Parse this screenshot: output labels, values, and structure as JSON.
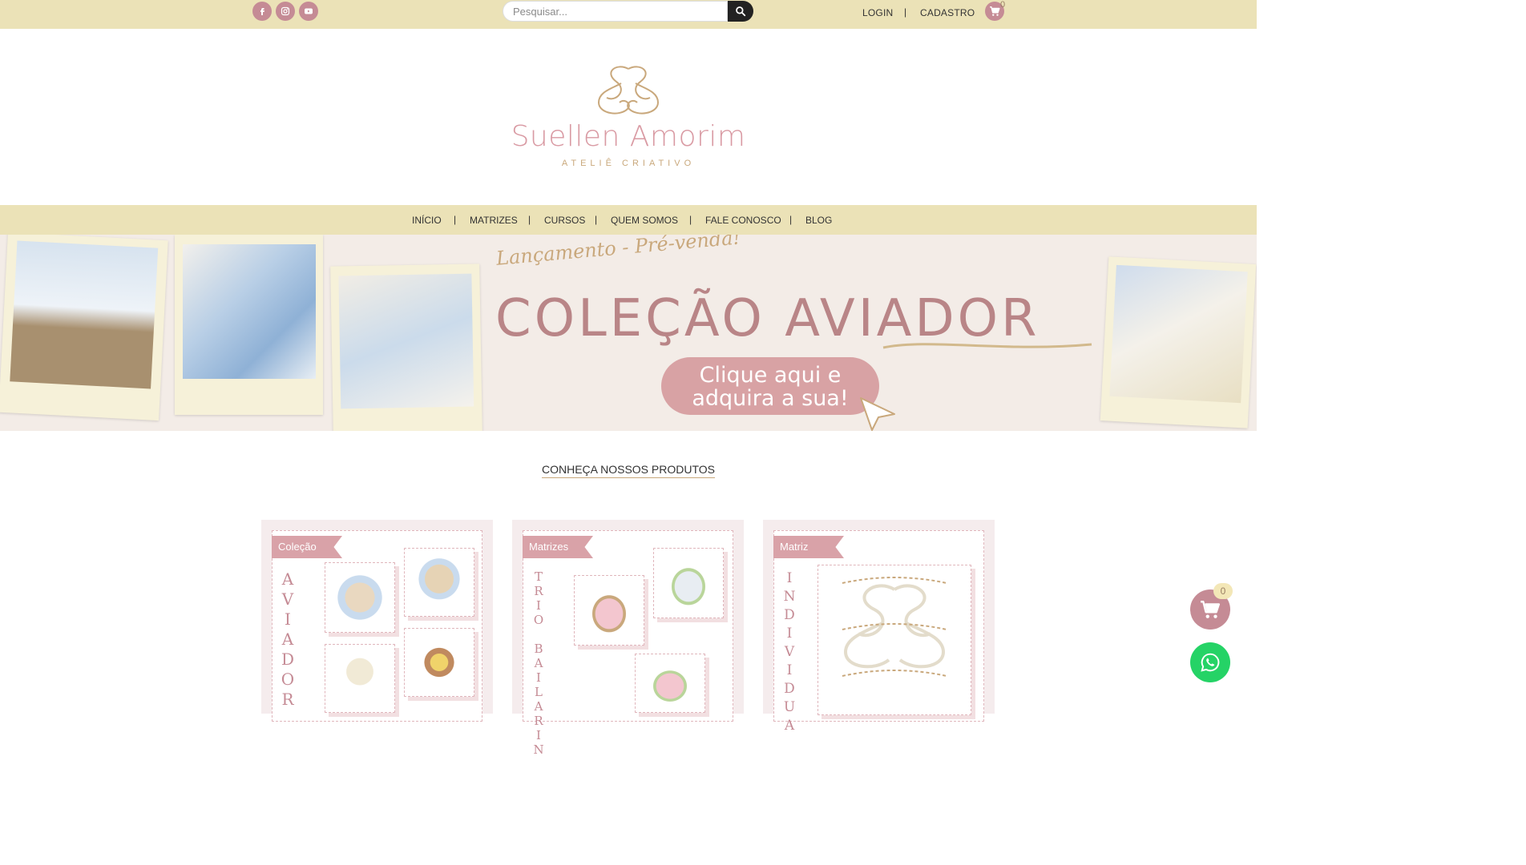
{
  "topbar": {
    "social": [
      {
        "icon": "facebook-icon"
      },
      {
        "icon": "instagram-icon"
      },
      {
        "icon": "youtube-icon"
      }
    ],
    "search": {
      "placeholder": "Pesquisar..."
    },
    "login": "LOGIN",
    "separator": "|",
    "register": "CADASTRO",
    "cart_count": "0"
  },
  "logo": {
    "name": "Suellen Amorim",
    "tagline": "ATELIÊ CRIATIVO"
  },
  "nav": {
    "items": [
      "INÍCIO",
      "MATRIZES",
      "CURSOS",
      "QUEM SOMOS",
      "FALE CONOSCO",
      "BLOG"
    ],
    "separator": "|"
  },
  "banner": {
    "subtitle": "Lançamento - Pré-venda!",
    "title": "COLEÇÃO AVIADOR",
    "cta_line1": "Clique aqui e",
    "cta_line2": "adquira a sua!"
  },
  "products": {
    "section_title": "CONHEÇA NOSSOS PRODUTOS",
    "cards": [
      {
        "tag": "Coleção",
        "vertical": [
          "A",
          "V",
          "I",
          "A",
          "D",
          "O",
          "R"
        ]
      },
      {
        "tag": "Matrizes",
        "vertical": [
          "T",
          "R",
          "I",
          "O",
          "",
          "B",
          "A",
          "I",
          "L",
          "A",
          "R",
          "I",
          "N"
        ]
      },
      {
        "tag": "Matriz",
        "vertical": [
          "I",
          "N",
          "D",
          "I",
          "V",
          "I",
          "D",
          "U",
          "A"
        ]
      }
    ]
  },
  "floating": {
    "cart_count": "0"
  },
  "colors": {
    "topbar_bg": "#ebe2b7",
    "accent_pink": "#c58b95",
    "gold": "#c9a87c",
    "whatsapp": "#25d366"
  }
}
